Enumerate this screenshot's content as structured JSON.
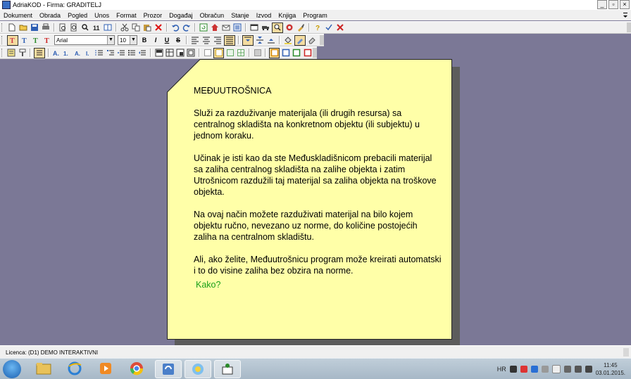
{
  "window": {
    "title": "AdriaKOD - Firma: GRADITELJ",
    "controls": [
      "_",
      "▫",
      "×"
    ]
  },
  "menu": [
    "Dokument",
    "Obrada",
    "Pogled",
    "Unos",
    "Format",
    "Prozor",
    "Događaj",
    "Obračun",
    "Stanje",
    "Izvod",
    "Knjiga",
    "Program"
  ],
  "format_toolbar": {
    "font": "Arial",
    "size": "10",
    "bold": "B",
    "italic": "I",
    "underline": "U",
    "strike": "S"
  },
  "note": {
    "heading": "MEĐUUTROŠNICA",
    "paragraphs": [
      "Služi za razduživanje materijala (ili drugih resursa) sa centralnog skladišta na konkretnom objektu (ili subjektu) u jednom koraku.",
      "Učinak je isti kao da ste Međuskladišnicom prebacili materijal sa zaliha centralnog skladišta na zalihe objekta i zatim Utrošnicom razdužili taj materijal sa zaliha objekta na troškove objekta.",
      "Na ovaj način možete razduživati materijal na bilo kojem objektu ručno, nevezano uz norme, do količine postojećih zaliha na centralnom skladištu.",
      "Ali, ako želite, Međuutrošnicu program može kreirati automatski i to do visine zaliha bez obzira na norme."
    ],
    "link": "Kako?"
  },
  "status": {
    "license": "Licenca:  (D1) DEMO INTERAKTIVNI"
  },
  "taskbar": {
    "lang": "HR",
    "time": "11:45",
    "date": "03.01.2015."
  }
}
